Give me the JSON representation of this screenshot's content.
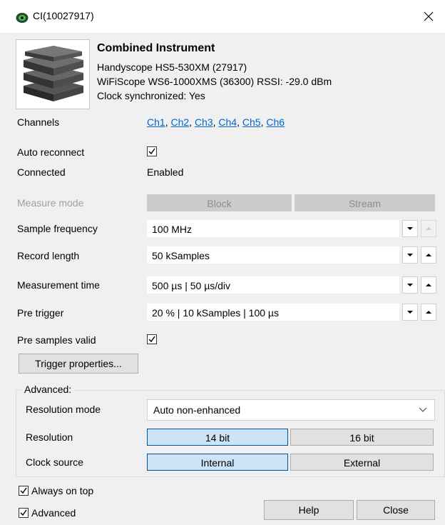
{
  "window": {
    "title": "CI(10027917)"
  },
  "device": {
    "name": "Combined Instrument",
    "lines": [
      "Handyscope HS5-530XM (27917)",
      "WiFiScope WS6-1000XMS (36300) RSSI: -29.0  dBm",
      "Clock synchronized: Yes"
    ]
  },
  "labels": {
    "channels": "Channels",
    "auto_reconnect": "Auto reconnect",
    "connected": "Connected",
    "measure_mode": "Measure mode",
    "sample_frequency": "Sample frequency",
    "record_length": "Record length",
    "measurement_time": "Measurement time",
    "pre_trigger": "Pre trigger",
    "pre_samples_valid": "Pre samples valid",
    "resolution_mode": "Resolution mode",
    "resolution": "Resolution",
    "clock_source": "Clock source"
  },
  "channels": [
    "Ch1",
    "Ch2",
    "Ch3",
    "Ch4",
    "Ch5",
    "Ch6"
  ],
  "channel_separator": ", ",
  "values": {
    "connected": "Enabled",
    "sample_frequency": "100 MHz",
    "record_length": "50 kSamples",
    "measurement_time": "500 µs | 50 µs/div",
    "pre_trigger": "20 % | 10 kSamples | 100 µs"
  },
  "measure_mode": {
    "options": [
      "Block",
      "Stream"
    ],
    "enabled": false
  },
  "auto_reconnect_checked": true,
  "pre_samples_valid_checked": true,
  "buttons": {
    "trigger_properties": "Trigger properties...",
    "help": "Help",
    "close": "Close"
  },
  "advanced_group": {
    "title": "Advanced:",
    "resolution_mode": "Auto non-enhanced",
    "resolution_options": [
      "14 bit",
      "16 bit"
    ],
    "resolution_selected": "14 bit",
    "clock_options": [
      "Internal",
      "External"
    ],
    "clock_selected": "Internal"
  },
  "bottom": {
    "always_on_top": "Always on top",
    "advanced": "Advanced",
    "always_on_top_checked": true,
    "advanced_checked": true
  },
  "colors": {
    "link": "#0066cc",
    "selected_segment": "#cce4f7",
    "selected_border": "#005499",
    "window_bg": "#f0f0f0"
  }
}
